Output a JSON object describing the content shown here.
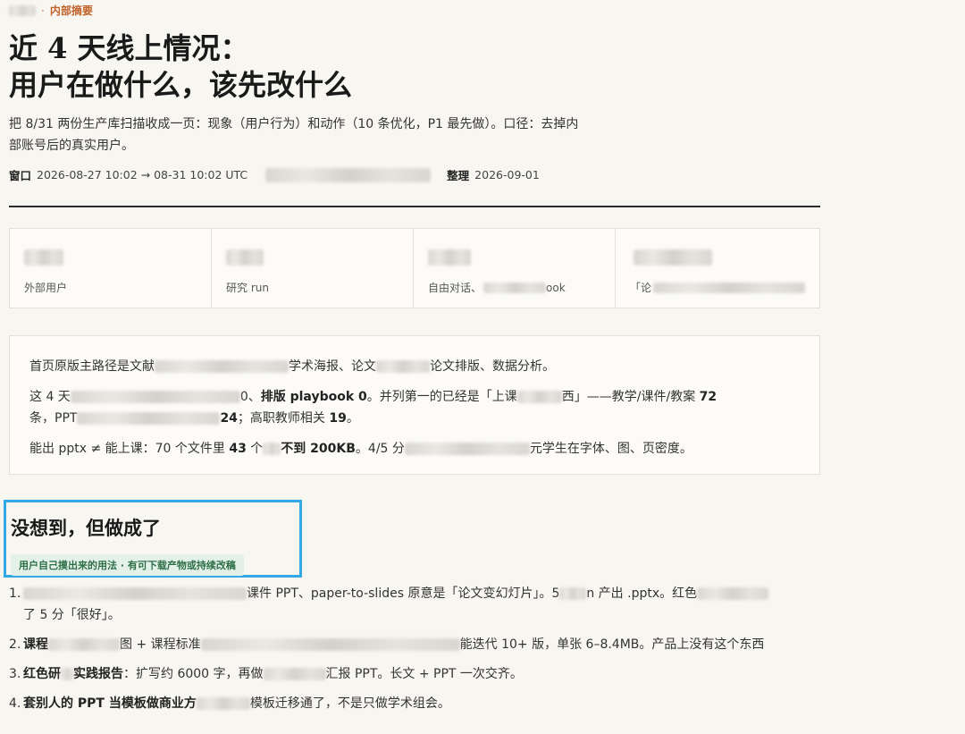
{
  "kicker": {
    "dot": "·",
    "label": "内部摘要"
  },
  "title": {
    "line1": "近 4 天线上情况：",
    "line2": "用户在做什么，该先改什么"
  },
  "lead": "把 8/31 两份生产库扫描收成一页：现象（用户行为）和动作（10 条优化，P1 最先做）。口径：去掉内部账号后的真实用户。",
  "meta": {
    "window_label": "窗口",
    "window_value": "2026-08-27 10:02 → 08-31 10:02 UTC",
    "compiled_label": "整理",
    "compiled_value": "2026-09-01"
  },
  "stats": [
    {
      "label": "外部用户"
    },
    {
      "label": "研究 run"
    },
    {
      "label_a": "自由对话、",
      "label_b": "ook"
    },
    {
      "label_a": "「论",
      "label_b": ""
    }
  ],
  "summary": {
    "p1_a": "首页原版主路径是文献",
    "p1_b": "学术海报、论文",
    "p1_c": "论文排版、数据分析。",
    "p2_a": "这 4 天",
    "p2_b": "0、",
    "p2_bold1": "排版 playbook 0",
    "p2_c": "。并列第一的已经是「上课",
    "p2_d": "西」——教学/课件/教案 ",
    "p2_n72": "72",
    "p2_e": "条，PPT",
    "p2_n24": "24",
    "p2_f": "；高职教师相关 ",
    "p2_n19": "19",
    "p2_g": "。",
    "p3_a": "能出 pptx ≠ 能上课：70 个文件里 ",
    "p3_n43": "43",
    "p3_b": " 个",
    "p3_bold": "不到 200KB",
    "p3_c": "。4/5 分",
    "p3_d": "元学生在字体、图、页密度。"
  },
  "section": {
    "title": "没想到，但做成了",
    "tag": "用户自己摸出来的用法 · 有可下载产物或持续改稿"
  },
  "list": [
    {
      "num": "1.",
      "a": "课件 PPT、paper-to-slides 原意是「论文变幻灯片」。5",
      "b": "n 产出 .pptx。红色",
      "c": "了 5 分「很好」。"
    },
    {
      "num": "2.",
      "bold": "课程",
      "a": "图 + 课程标准",
      "b": "能迭代 10+ 版，单张 6–8.4MB。产品上没有这个东西"
    },
    {
      "num": "3.",
      "bold1": "红色研",
      "bold2": "实践报告",
      "a": "：扩写约 6000 字，再做",
      "b": "汇报 PPT。长文 + PPT 一次交齐。"
    },
    {
      "num": "4.",
      "bold": "套别人的 PPT 当模板做商业方",
      "a": "模板迁移通了，不是只做学术组会。"
    }
  ]
}
